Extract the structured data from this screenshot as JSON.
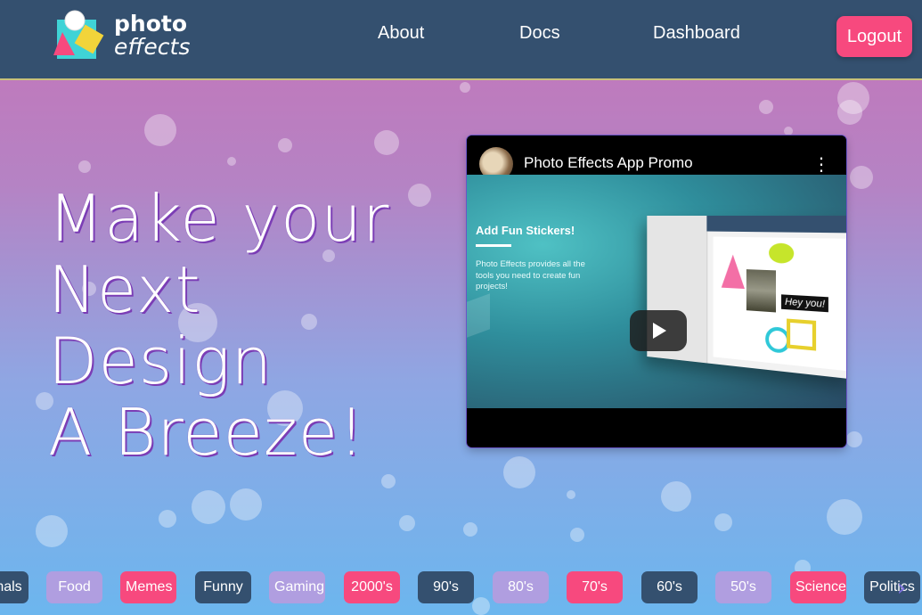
{
  "brand": {
    "line1": "photo",
    "line2": "effects"
  },
  "nav": {
    "links": [
      "About",
      "Docs",
      "Dashboard"
    ],
    "logout_label": "Logout"
  },
  "hero": {
    "lines": [
      "Make your",
      "Next",
      "Design",
      "A Breeze!"
    ]
  },
  "video": {
    "title": "Photo Effects App Promo",
    "menu_icon": "more-vert-icon",
    "slide_heading": "Add Fun Stickers!",
    "slide_text": "Photo Effects provides all the tools you need to create fun projects!",
    "sticker_text": "Hey you!"
  },
  "categories": [
    {
      "label": "nals",
      "style": "dark"
    },
    {
      "label": "Food",
      "style": "lav"
    },
    {
      "label": "Memes",
      "style": "pink"
    },
    {
      "label": "Funny",
      "style": "dark"
    },
    {
      "label": "Gaming",
      "style": "lav"
    },
    {
      "label": "2000's",
      "style": "pink"
    },
    {
      "label": "90's",
      "style": "dark"
    },
    {
      "label": "80's",
      "style": "lav"
    },
    {
      "label": "70's",
      "style": "pink"
    },
    {
      "label": "60's",
      "style": "dark"
    },
    {
      "label": "50's",
      "style": "lav"
    },
    {
      "label": "Science",
      "style": "pink"
    },
    {
      "label": "Politics",
      "style": "dark"
    }
  ],
  "colors": {
    "navbar": "#34506f",
    "accent_pink": "#f7497e",
    "lavender": "#b09ee0"
  }
}
